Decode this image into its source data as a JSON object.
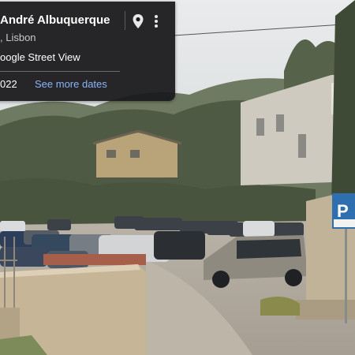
{
  "info_card": {
    "title": "André Albuquerque",
    "subtitle": ", Lisbon",
    "source": "oogle Street View",
    "date": "022",
    "see_more": "See more dates"
  },
  "icons": {
    "pin": "map-pin-icon",
    "more": "more-vert-icon"
  },
  "sign": {
    "letter": "P"
  },
  "colors": {
    "card_bg": "#1a1a1c",
    "link": "#8ab4f8",
    "sign_blue": "#2f6fb0"
  }
}
